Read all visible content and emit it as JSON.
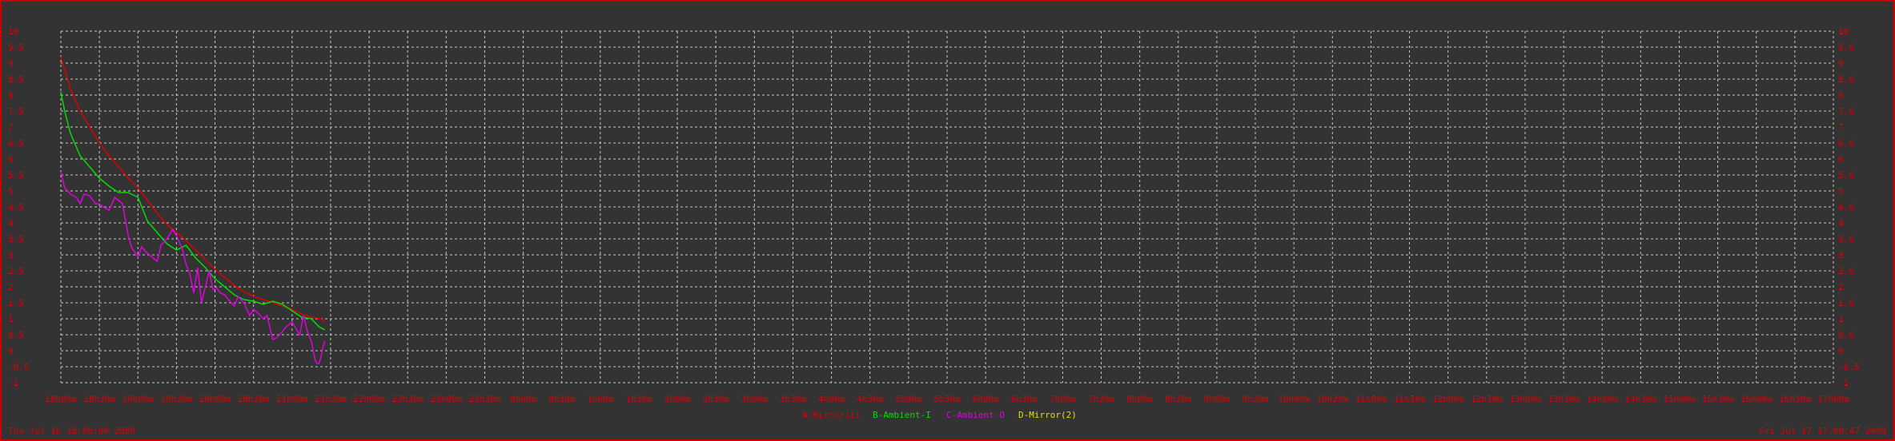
{
  "chart_data": {
    "type": "line",
    "title": "",
    "xlabel": "",
    "ylabel": "",
    "ylim": [
      -1,
      10
    ],
    "y_ticks": [
      "-1",
      "-0.5",
      "0",
      "0.5",
      "1",
      "1.5",
      "2",
      "2.5",
      "3",
      "3.5",
      "4",
      "4.5",
      "5",
      "5.5",
      "6",
      "6.5",
      "7",
      "7.5",
      "8",
      "8.5",
      "9",
      "9.5",
      "10"
    ],
    "x_ticks": [
      "18h00m",
      "18h30m",
      "19h00m",
      "19h30m",
      "20h00m",
      "20h30m",
      "21h00m",
      "21h30m",
      "22h00m",
      "22h30m",
      "23h00m",
      "23h30m",
      "0h00m",
      "0h30m",
      "1h00m",
      "1h30m",
      "2h00m",
      "2h30m",
      "3h00m",
      "3h30m",
      "4h00m",
      "4h30m",
      "5h00m",
      "5h30m",
      "6h00m",
      "6h30m",
      "7h00m",
      "7h30m",
      "8h00m",
      "8h30m",
      "9h00m",
      "9h30m",
      "10h00m",
      "10h30m",
      "11h00m",
      "11h30m",
      "12h00m",
      "12h30m",
      "13h00m",
      "13h30m",
      "14h00m",
      "14h30m",
      "15h00m",
      "15h30m",
      "16h00m",
      "16h30m",
      "17h00m"
    ],
    "x_unit": "hours since 18h00m",
    "grid": true,
    "legend_position": "bottom-center",
    "start_label": "Thu Jul 16 18:00:00 2009",
    "end_label": "Fri Jul 17 17:00:47 2009",
    "series": [
      {
        "name": "A-Mirror(1)",
        "color": "#e00000",
        "x": [
          0,
          0.25,
          0.5,
          0.75,
          1.0,
          1.25,
          1.5,
          1.75,
          2.0,
          2.25,
          2.5,
          2.75,
          3.0,
          3.25,
          3.5,
          3.75,
          4.0,
          4.25,
          4.5,
          4.75,
          5.0,
          5.25,
          5.5,
          5.75,
          6.0,
          6.25,
          6.5,
          6.75,
          6.85
        ],
        "y": [
          9.2,
          8.2,
          7.5,
          7.0,
          6.5,
          6.1,
          5.75,
          5.4,
          5.1,
          4.7,
          4.3,
          3.95,
          3.7,
          3.45,
          3.15,
          2.85,
          2.55,
          2.3,
          2.05,
          1.85,
          1.7,
          1.6,
          1.5,
          1.4,
          1.3,
          1.15,
          1.05,
          1.0,
          0.9
        ]
      },
      {
        "name": "B-Ambient-I",
        "color": "#00e000",
        "x": [
          0,
          0.1,
          0.25,
          0.5,
          0.75,
          1.0,
          1.25,
          1.5,
          1.75,
          2.0,
          2.1,
          2.25,
          2.5,
          2.75,
          3.0,
          3.25,
          3.5,
          3.75,
          4.0,
          4.25,
          4.5,
          4.75,
          5.0,
          5.25,
          5.5,
          5.75,
          6.0,
          6.25,
          6.5,
          6.7,
          6.85
        ],
        "y": [
          8.1,
          7.5,
          6.8,
          6.1,
          5.75,
          5.4,
          5.15,
          4.95,
          4.95,
          4.8,
          4.5,
          4.05,
          3.7,
          3.35,
          3.15,
          3.3,
          2.9,
          2.6,
          2.25,
          2.0,
          1.75,
          1.6,
          1.55,
          1.45,
          1.55,
          1.45,
          1.25,
          1.05,
          1.0,
          0.75,
          0.65
        ]
      },
      {
        "name": "C-Ambient-O",
        "color": "#e000e0",
        "x": [
          0,
          0.1,
          0.25,
          0.4,
          0.5,
          0.6,
          0.75,
          0.9,
          1.0,
          1.1,
          1.25,
          1.4,
          1.5,
          1.6,
          1.75,
          1.85,
          2.0,
          2.1,
          2.2,
          2.35,
          2.5,
          2.6,
          2.75,
          2.9,
          3.0,
          3.15,
          3.25,
          3.35,
          3.45,
          3.55,
          3.65,
          3.75,
          3.85,
          3.95,
          4.05,
          4.15,
          4.25,
          4.35,
          4.5,
          4.6,
          4.75,
          4.9,
          5.0,
          5.1,
          5.25,
          5.35,
          5.5,
          5.6,
          5.75,
          5.85,
          6.0,
          6.1,
          6.2,
          6.3,
          6.4,
          6.5,
          6.6,
          6.65,
          6.7,
          6.75,
          6.8,
          6.85
        ],
        "y": [
          5.6,
          5.1,
          4.9,
          4.8,
          4.6,
          4.9,
          4.85,
          4.6,
          4.6,
          4.5,
          4.4,
          4.8,
          4.7,
          4.6,
          3.6,
          3.2,
          2.95,
          3.25,
          3.1,
          2.95,
          2.8,
          3.3,
          3.5,
          3.8,
          3.6,
          3.2,
          2.7,
          2.4,
          1.8,
          2.6,
          1.5,
          2.0,
          2.5,
          1.9,
          1.95,
          1.8,
          1.75,
          1.6,
          1.4,
          1.7,
          1.5,
          1.1,
          1.3,
          1.2,
          1.0,
          1.1,
          0.35,
          0.4,
          0.6,
          0.75,
          0.9,
          0.7,
          0.5,
          1.1,
          0.6,
          0.3,
          -0.3,
          -0.4,
          -0.4,
          -0.2,
          0.1,
          0.3
        ]
      },
      {
        "name": "D-Mirror(2)",
        "color": "#e0e000",
        "x": [],
        "y": []
      }
    ]
  }
}
